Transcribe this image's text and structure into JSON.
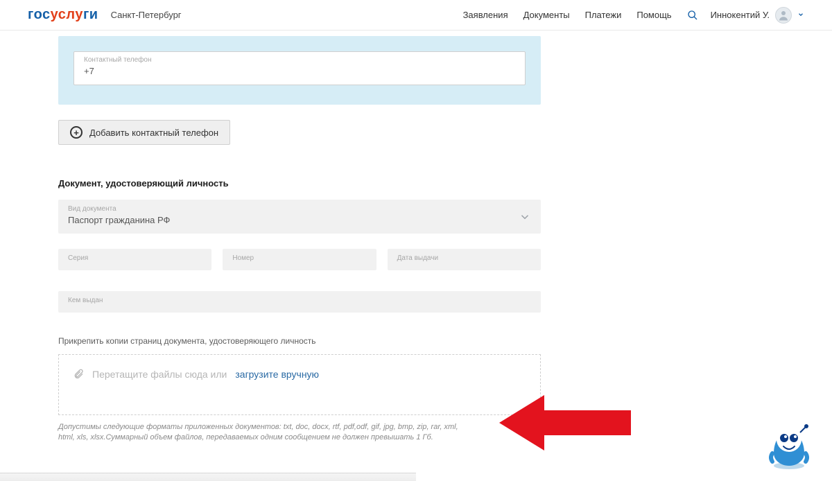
{
  "header": {
    "logo_p1": "гос",
    "logo_p2": "услу",
    "logo_p3": "ги",
    "city": "Санкт-Петербург",
    "nav": {
      "applications": "Заявления",
      "documents": "Документы",
      "payments": "Платежи",
      "help": "Помощь"
    },
    "user_name": "Иннокентий У."
  },
  "phone": {
    "label": "Контактный телефон",
    "value": "+7"
  },
  "add_phone": "Добавить контактный телефон",
  "section_title": "Документ, удостоверяющий личность",
  "doc_type": {
    "label": "Вид документа",
    "value": "Паспорт гражданина РФ"
  },
  "passport": {
    "series_label": "Серия",
    "series_value": "",
    "number_label": "Номер",
    "number_value": "",
    "issue_date_label": "Дата выдачи",
    "issue_date_value": "",
    "issued_by_label": "Кем выдан",
    "issued_by_value": ""
  },
  "attach_label": "Прикрепить копии страниц документа, удостоверяющего личность",
  "dropzone": {
    "drag": "Перетащите файлы сюда или",
    "upload_link": "загрузите вручную"
  },
  "formats_hint": "Допустимы следующие форматы приложенных документов: txt, doc, docx, rtf, pdf,odf, gif, jpg, bmp, zip, rar, xml, html, xls, xlsx.Суммарный объем файлов, передаваемых одним сообщением не должен превышать 1 Гб."
}
